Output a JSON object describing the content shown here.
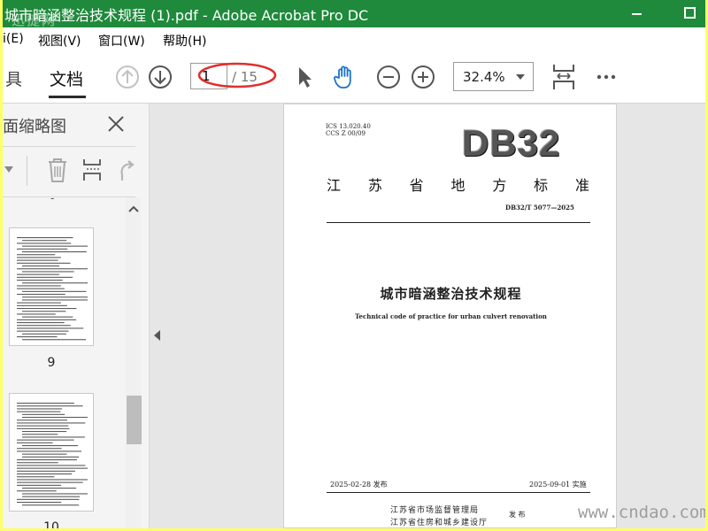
{
  "window": {
    "title": "城市暗涵整治技术规程 (1).pdf - Adobe Acrobat Pro DC",
    "watermark_top": "迅捷网"
  },
  "menu": {
    "items": [
      "i(E)",
      "视图(V)",
      "窗口(W)",
      "帮助(H)"
    ]
  },
  "toolbar": {
    "tabs": [
      "具",
      "文档"
    ],
    "current_page": "1",
    "total_pages": "/ 15",
    "zoom": "32.4%",
    "icons": [
      "arrow-up-circle-icon",
      "arrow-down-circle-icon",
      "pointer-icon",
      "hand-icon",
      "zoom-out-icon",
      "zoom-in-icon",
      "fit-page-icon",
      "more-icon"
    ]
  },
  "sidebar": {
    "title": "面缩略图",
    "pages": [
      "9",
      "10"
    ],
    "dash_above": "-"
  },
  "document": {
    "ics_line1": "ICS 13.020.40",
    "ics_line2": "CCS Z 00/09",
    "logo": "DB32",
    "std_type_chars": [
      "江",
      "苏",
      "省",
      "地",
      "方",
      "标",
      "准"
    ],
    "std_no": "DB32/T 5077—2025",
    "title_cn": "城市暗涵整治技术规程",
    "title_en": "Technical code of practice for urban culvert renovation",
    "issue_date": "2025-02-28 发布",
    "impl_date": "2025-09-01 实施",
    "issuer1": "江苏省市场监督管理局",
    "issuer2": "江苏省住房和城乡建设厅",
    "publish": "发 布"
  },
  "colors": {
    "titlebar": "#1f8a3b",
    "annotation": "#e03030",
    "hand_active": "#1a73c9"
  },
  "watermark": "www.cndao.com"
}
